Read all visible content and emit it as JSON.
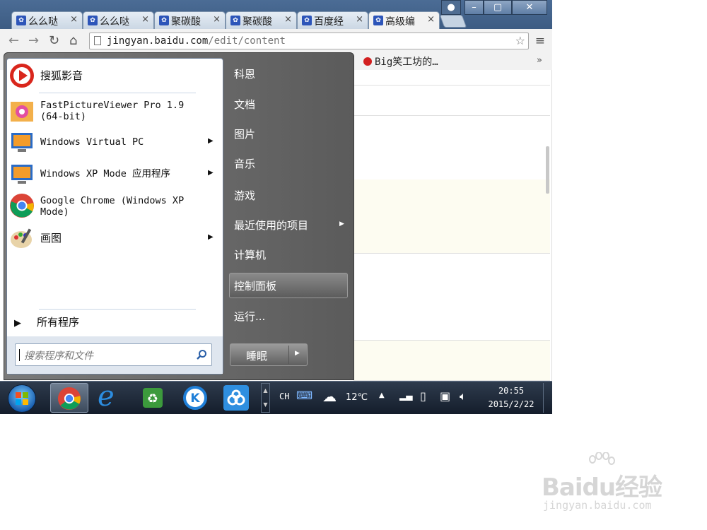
{
  "browser": {
    "tabs": [
      {
        "title": "么么哒",
        "active": false
      },
      {
        "title": "么么哒",
        "active": false
      },
      {
        "title": "聚碳酸",
        "active": false
      },
      {
        "title": "聚碳酸",
        "active": false
      },
      {
        "title": "百度经",
        "active": false
      },
      {
        "title": "高级编",
        "active": true
      }
    ],
    "url_host": "jingyan.baidu.com",
    "url_path": "/edit/content",
    "bookmark_label": "Big笑工坊的…",
    "bookmark_more": "»"
  },
  "start_menu": {
    "programs": [
      {
        "label": "搜狐影音",
        "icon": "sohu-video-icon",
        "has_submenu": false
      },
      {
        "label": "FastPictureViewer Pro 1.9 (64-bit)",
        "icon": "fastpictureviewer-icon",
        "has_submenu": false
      },
      {
        "label": "Windows Virtual PC",
        "icon": "virtual-pc-icon",
        "has_submenu": true
      },
      {
        "label": "Windows XP Mode 应用程序",
        "icon": "xp-mode-icon",
        "has_submenu": true
      },
      {
        "label": "Google Chrome (Windows XP Mode)",
        "icon": "chrome-icon",
        "has_submenu": false
      },
      {
        "label": "画图",
        "icon": "paint-icon",
        "has_submenu": true
      }
    ],
    "all_programs": "所有程序",
    "search_placeholder": "搜索程序和文件",
    "right_items": [
      {
        "label": "科恩"
      },
      {
        "label": "文档"
      },
      {
        "label": "图片"
      },
      {
        "label": "音乐"
      },
      {
        "label": "游戏"
      },
      {
        "label": "最近使用的项目"
      },
      {
        "label": "计算机"
      },
      {
        "label": "控制面板"
      },
      {
        "label": "运行..."
      }
    ],
    "highlighted_item": "控制面板",
    "sleep_label": "睡眠"
  },
  "taskbar": {
    "lang": "CH",
    "weather_temp": "12℃",
    "time": "20:55",
    "date": "2015/2/22"
  },
  "watermark": {
    "logo": "Baidu经验",
    "url": "jingyan.baidu.com"
  }
}
